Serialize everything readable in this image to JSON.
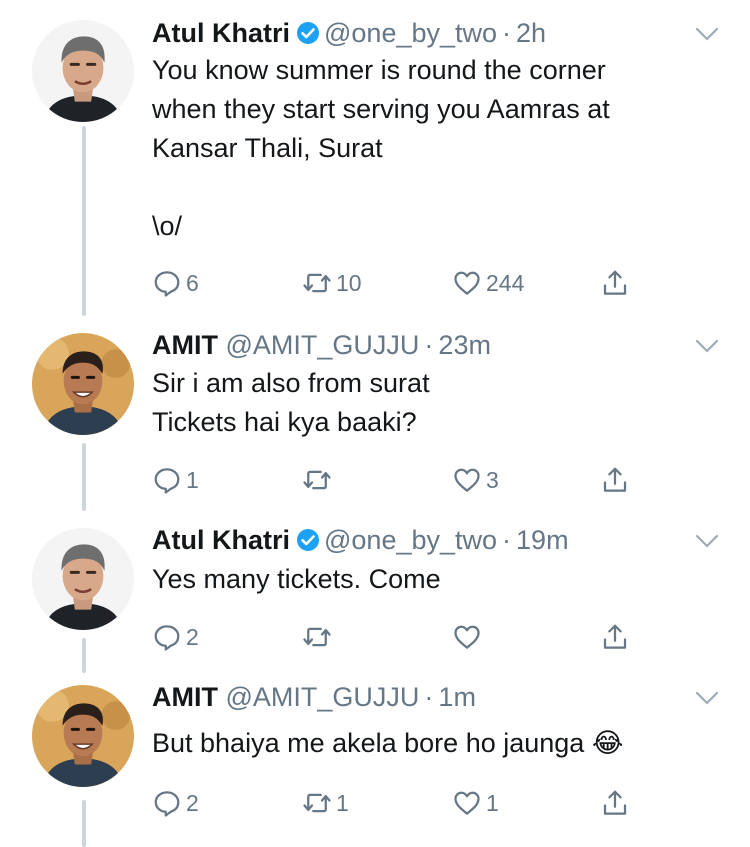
{
  "tweets": [
    {
      "name": "Atul Khatri",
      "verified": true,
      "handle": "@one_by_two",
      "dot": "·",
      "time": "2h",
      "text": "You know summer is round the corner\nwhen they start serving you Aamras at\nKansar Thali, Surat\n\n\\o/",
      "replies": "6",
      "retweets": "10",
      "likes": "244"
    },
    {
      "name": "AMIT",
      "verified": false,
      "handle": "@AMIT_GUJJU",
      "dot": "·",
      "time": "23m",
      "text": "Sir i am also from surat\nTickets hai kya baaki?",
      "replies": "1",
      "retweets": "",
      "likes": "3"
    },
    {
      "name": "Atul Khatri",
      "verified": true,
      "handle": "@one_by_two",
      "dot": "·",
      "time": "19m",
      "text": "Yes many tickets. Come",
      "replies": "2",
      "retweets": "",
      "likes": ""
    },
    {
      "name": "AMIT",
      "verified": false,
      "handle": "@AMIT_GUJJU",
      "dot": "·",
      "time": "1m",
      "text": "But bhaiya me akela bore ho jaunga",
      "emoji": "😂",
      "replies": "2",
      "retweets": "1",
      "likes": "1"
    }
  ],
  "colors": {
    "text": "#14171a",
    "secondary": "#657786",
    "verified": "#1da1f2",
    "thread_line": "#ccd6dd"
  },
  "icons": [
    "reply-icon",
    "retweet-icon",
    "like-icon",
    "share-icon",
    "chevron-down-icon",
    "verified-badge-icon"
  ]
}
